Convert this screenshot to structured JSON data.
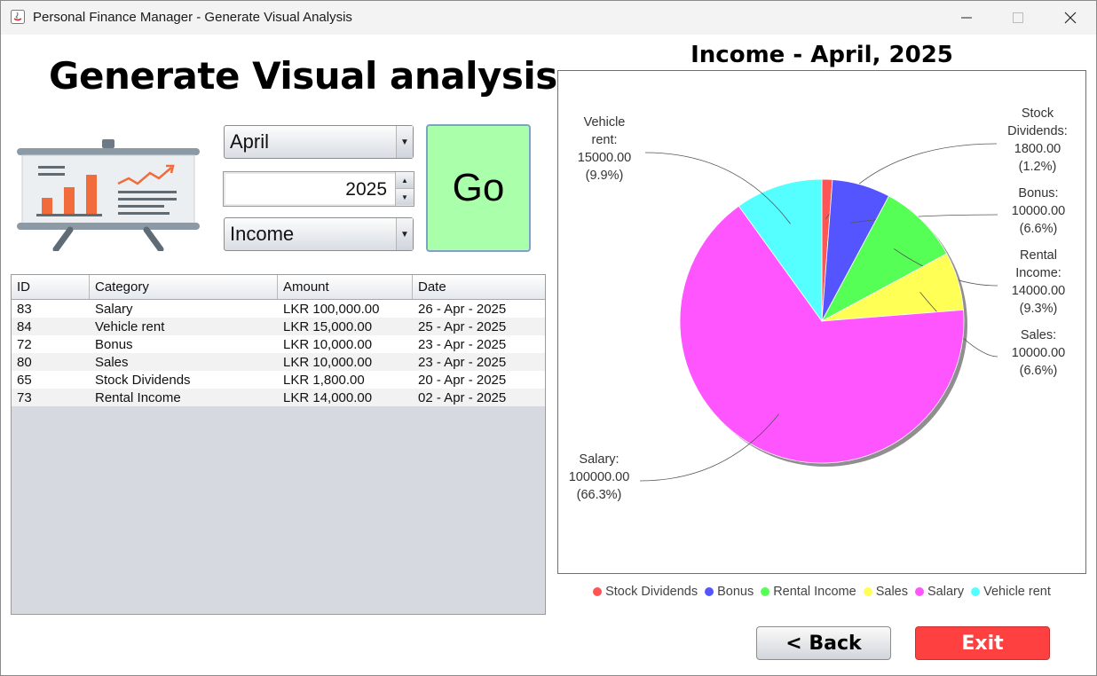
{
  "window": {
    "title": "Personal Finance Manager - Generate Visual Analysis",
    "controls": [
      "minimize-icon",
      "maximize-icon",
      "close-icon"
    ]
  },
  "header": {
    "title": "Generate Visual analysis"
  },
  "filters": {
    "month": "April",
    "year": "2025",
    "type": "Income",
    "go_label": "Go"
  },
  "table": {
    "columns": [
      "ID",
      "Category",
      "Amount",
      "Date"
    ],
    "rows": [
      {
        "id": "83",
        "category": "Salary",
        "amount": "LKR 100,000.00",
        "date": "26 - Apr - 2025"
      },
      {
        "id": "84",
        "category": "Vehicle rent",
        "amount": "LKR 15,000.00",
        "date": "25 - Apr - 2025"
      },
      {
        "id": "72",
        "category": "Bonus",
        "amount": "LKR 10,000.00",
        "date": "23 - Apr - 2025"
      },
      {
        "id": "80",
        "category": "Sales",
        "amount": "LKR 10,000.00",
        "date": "23 - Apr - 2025"
      },
      {
        "id": "65",
        "category": "Stock Dividends",
        "amount": "LKR 1,800.00",
        "date": "20 - Apr - 2025"
      },
      {
        "id": "73",
        "category": "Rental Income",
        "amount": "LKR 14,000.00",
        "date": "02 - Apr - 2025"
      }
    ]
  },
  "chart_data": {
    "type": "pie",
    "title": "Income - April, 2025",
    "slices": [
      {
        "name": "Stock Dividends",
        "value": 1800,
        "value_label": "1800.00",
        "pct": "(1.2%)",
        "color": "#ff5555",
        "label_lines": [
          "Stock",
          "Dividends:"
        ]
      },
      {
        "name": "Bonus",
        "value": 10000,
        "value_label": "10000.00",
        "pct": "(6.6%)",
        "color": "#5555ff",
        "label_lines": [
          "Bonus:"
        ]
      },
      {
        "name": "Rental Income",
        "value": 14000,
        "value_label": "14000.00",
        "pct": "(9.3%)",
        "color": "#55ff55",
        "label_lines": [
          "Rental",
          "Income:"
        ]
      },
      {
        "name": "Sales",
        "value": 10000,
        "value_label": "10000.00",
        "pct": "(6.6%)",
        "color": "#ffff55",
        "label_lines": [
          "Sales:"
        ]
      },
      {
        "name": "Salary",
        "value": 100000,
        "value_label": "100000.00",
        "pct": "(66.3%)",
        "color": "#ff55ff",
        "label_lines": [
          "Salary:"
        ]
      },
      {
        "name": "Vehicle rent",
        "value": 15000,
        "value_label": "15000.00",
        "pct": "(9.9%)",
        "color": "#55ffff",
        "label_lines": [
          "Vehicle",
          "rent:"
        ]
      }
    ],
    "legend": [
      "Stock Dividends",
      "Bonus",
      "Rental Income",
      "Sales",
      "Salary",
      "Vehicle rent"
    ],
    "legend_position": "bottom"
  },
  "buttons": {
    "back": "< Back",
    "exit": "Exit"
  }
}
